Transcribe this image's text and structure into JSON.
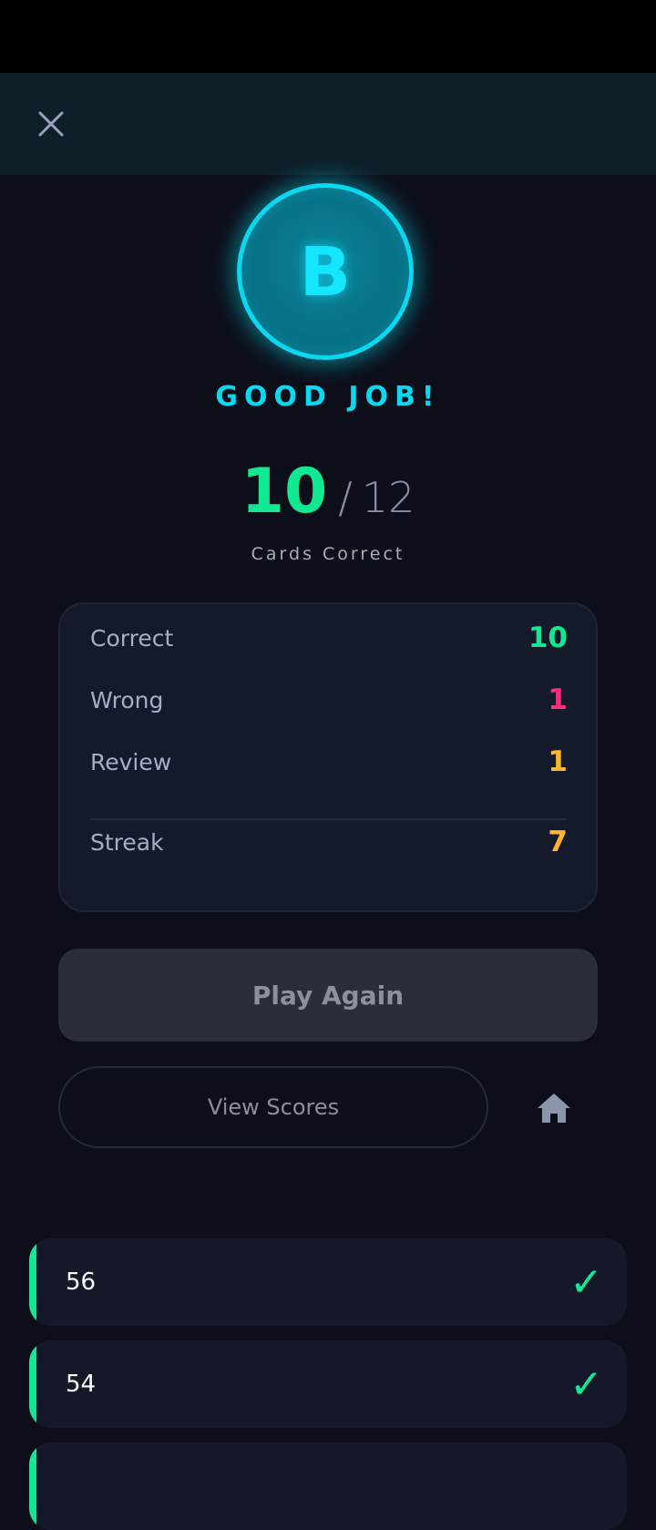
{
  "header": {
    "close_icon": "close-icon"
  },
  "result": {
    "grade": "B",
    "message": "GOOD JOB!",
    "correct": "10",
    "separator": "/",
    "total": "12",
    "caption": "Cards Correct"
  },
  "stats": [
    {
      "label": "Correct",
      "value": "10",
      "color": "#10e892"
    },
    {
      "label": "Wrong",
      "value": "1",
      "color": "#ff2d7a"
    },
    {
      "label": "Review",
      "value": "1",
      "color": "#ffb52e"
    },
    {
      "label": "Streak",
      "value": "7",
      "color": "#ffb52e"
    }
  ],
  "actions": {
    "play_again": "Play Again",
    "view_scores": "View Scores",
    "home_icon": "home-icon"
  },
  "answers": [
    {
      "text": "56",
      "status": "correct",
      "icon": "check-icon"
    },
    {
      "text": "54",
      "status": "correct",
      "icon": "check-icon"
    },
    {
      "text": "",
      "status": "correct",
      "icon": "check-icon"
    }
  ],
  "colors": {
    "accent_cyan": "#08d9f0",
    "correct_green": "#10e892",
    "wrong_pink": "#ff2d7a",
    "review_amber": "#ffb52e"
  }
}
